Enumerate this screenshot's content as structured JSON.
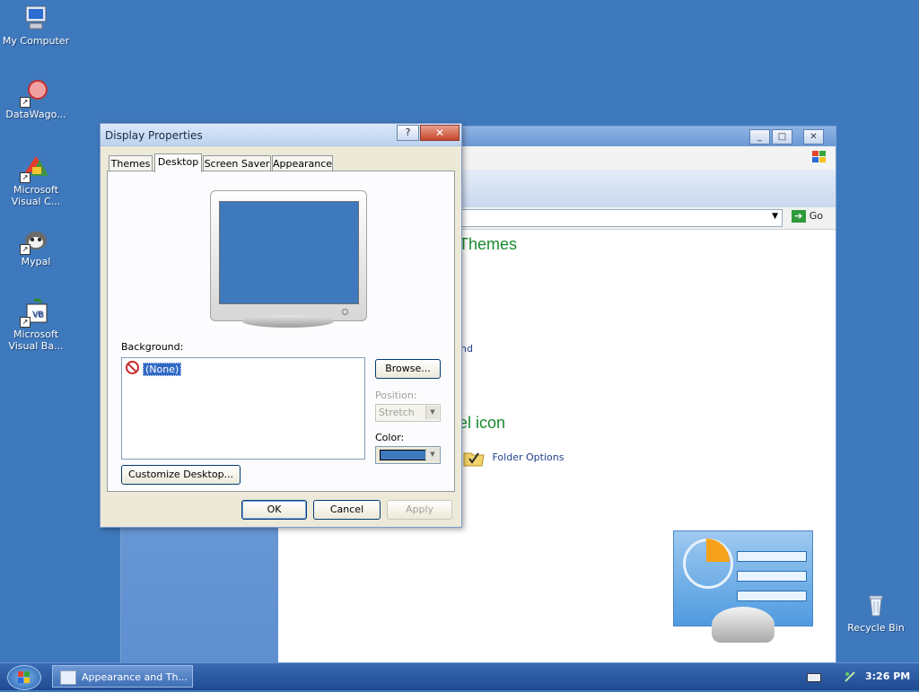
{
  "desktop": {
    "icons": [
      {
        "label": "My Computer",
        "icon": "computer-icon"
      },
      {
        "label": "DataWago...",
        "icon": "datawagon-icon"
      },
      {
        "label": "Microsoft Visual C...",
        "icon": "visual-c-icon"
      },
      {
        "label": "Mypal",
        "icon": "mypal-icon"
      },
      {
        "label": "Microsoft Visual Ba...",
        "icon": "visual-basic-icon"
      },
      {
        "label": "Recycle Bin",
        "icon": "recycle-bin-icon"
      }
    ]
  },
  "background_window": {
    "address_go": "Go",
    "heading_1": "Themes",
    "link_1": "nd",
    "heading_2": "el icon",
    "folder_options": "Folder Options"
  },
  "dialog": {
    "title": "Display Properties",
    "help_label": "?",
    "close_label": "✕",
    "tabs": [
      "Themes",
      "Desktop",
      "Screen Saver",
      "Appearance"
    ],
    "active_tab": "Desktop",
    "background_label": "Background:",
    "background_items": [
      "(None)"
    ],
    "browse_label": "Browse...",
    "position_label": "Position:",
    "position_value": "Stretch",
    "color_label": "Color:",
    "color_value": "#3f79bd",
    "customize_label": "Customize Desktop...",
    "ok_label": "OK",
    "cancel_label": "Cancel",
    "apply_label": "Apply"
  },
  "taskbar": {
    "task_label": "Appearance and Th...",
    "clock": "3:26 PM"
  },
  "colors": {
    "desktop": "#3f79bd",
    "dialog_face": "#ece9d8",
    "selection": "#316ac5",
    "heading_green": "#188a2e"
  }
}
